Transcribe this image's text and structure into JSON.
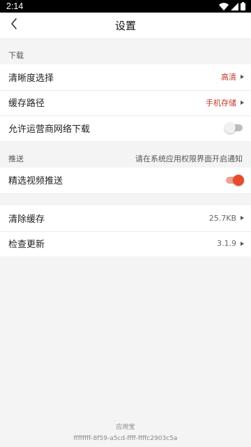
{
  "status_bar": {
    "time": "2:14",
    "icons": [
      "wifi-icon",
      "signal-icon",
      "battery-icon"
    ]
  },
  "header": {
    "title": "设置",
    "back_icon": "chevron-left-icon"
  },
  "download_section": {
    "header": "下载",
    "items": [
      {
        "label": "清晰度选择",
        "value": "高清"
      },
      {
        "label": "缓存路径",
        "value": "手机存储"
      },
      {
        "label": "允许运营商网络下载",
        "toggle": false
      }
    ]
  },
  "push_section": {
    "header": "推送",
    "hint": "请在系统应用权限界面开启通知",
    "items": [
      {
        "label": "精选视频推送",
        "toggle": true
      }
    ]
  },
  "other_section": {
    "items": [
      {
        "label": "清除缓存",
        "value": "25.7KB"
      },
      {
        "label": "检查更新",
        "value": "3.1.9"
      }
    ]
  },
  "footer": {
    "source": "应用宝",
    "device_id": "ffffffff-8f59-a5cd-ffff-ffffc2903c5a"
  },
  "colors": {
    "accent": "#e84b2c",
    "accent_track": "#f0a18f",
    "value_red": "#c0392b",
    "background": "#f4f4f4"
  }
}
